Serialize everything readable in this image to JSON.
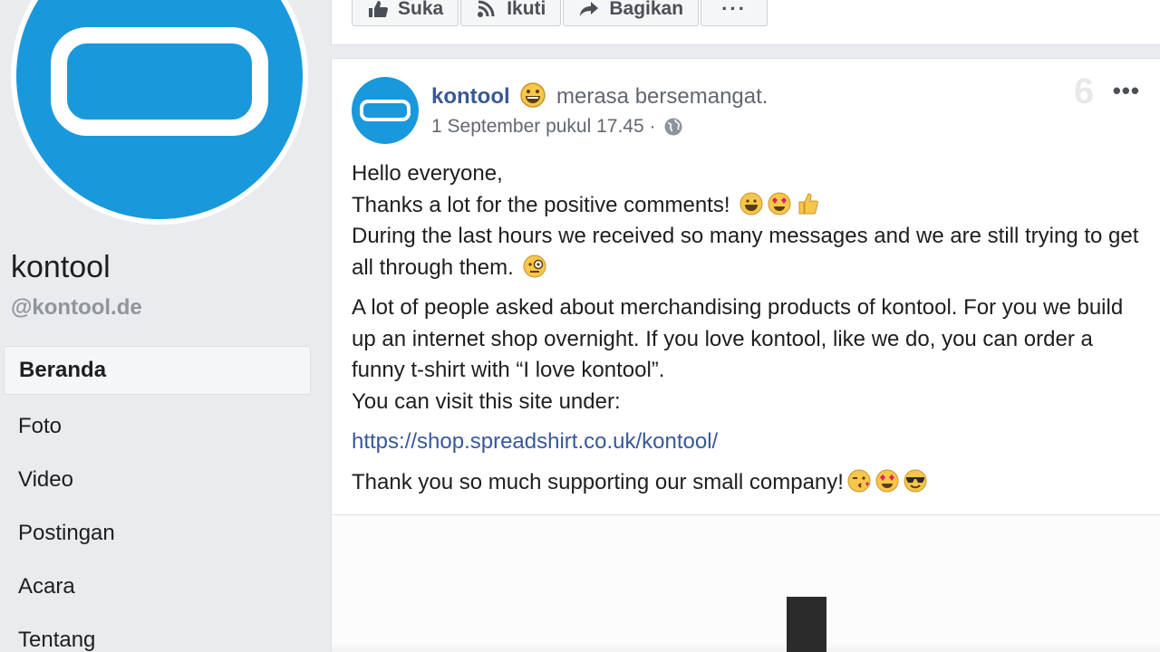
{
  "sidebar": {
    "page_name": "kontool",
    "handle": "@kontool.de",
    "nav": [
      "Beranda",
      "Foto",
      "Video",
      "Postingan",
      "Acara",
      "Tentang"
    ]
  },
  "top_actions": {
    "like": "Suka",
    "follow": "Ikuti",
    "share": "Bagikan",
    "more": "···"
  },
  "post": {
    "author": "kontool",
    "feeling": "merasa bersemangat.",
    "timestamp": "1 September pukul 17.45 ·",
    "menu": "•••",
    "lines": {
      "l1": "Hello everyone,",
      "l2": "Thanks a lot for the positive comments! ",
      "l3": "During the last hours we received so many messages and we are still trying to get all through them. ",
      "l4": "A lot of people asked about merchandising products of kontool. For you we build up an internet shop overnight. If you love kontool, like we do, you can order a funny t-shirt with “I love kontool”.",
      "l5": "You can visit this site under:",
      "link": "https://shop.spreadshirt.co.uk/kontool/",
      "l6": "Thank you so much supporting our small company!"
    }
  },
  "watermark": "6",
  "colors": {
    "brand_blue": "#1a98dc",
    "link": "#385898",
    "background": "#e9ebee"
  }
}
